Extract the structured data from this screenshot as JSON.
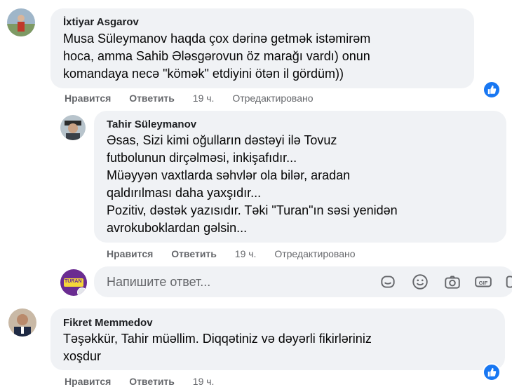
{
  "actions": {
    "like": "Нравится",
    "reply": "Ответить",
    "edited": "Отредактировано"
  },
  "comments": [
    {
      "author": "İxtiyar Asgarov",
      "text": "Musa Süleymanov haqda çox dərinə getmək istəmirəm\nhoca, amma Sahib Ələsgərovun öz marağı vardı) onun\nkomandaya necə \"kömək\" etdiyini ötən il gördüm))",
      "time": "19 ч."
    },
    {
      "author": "Tahir Süleymanov",
      "text": "Əsas, Sizi kimi oğulların dəstəyi ilə Tovuz\nfutbolunun dirçəlməsi, inkişafıdır...\nMüəyyən vaxtlarda səhvlər ola bilər, aradan\nqaldırılması daha yaxşıdır...\nPozitiv, dəstək yazısıdır. Təki \"Turan\"ın səsi yenidən\navrokuboklardan gəlsin...",
      "time": "19 ч."
    },
    {
      "author": "Fikret Memmedov",
      "text": "Təşəkkür, Tahir müəllim. Diqqətiniz və dəyərli fikirləriniz\nxoşdur",
      "time": "19 ч."
    }
  ],
  "reply_box": {
    "placeholder": "Напишите ответ...",
    "avatar_text": "TURAN"
  },
  "colors": {
    "bubble": "#f0f2f5",
    "meta_text": "#65676b",
    "like_blue": "#1877f2"
  },
  "icons": [
    "like-icon",
    "sticker-icon",
    "emoji-icon",
    "camera-icon",
    "gif-icon",
    "more-icon"
  ]
}
